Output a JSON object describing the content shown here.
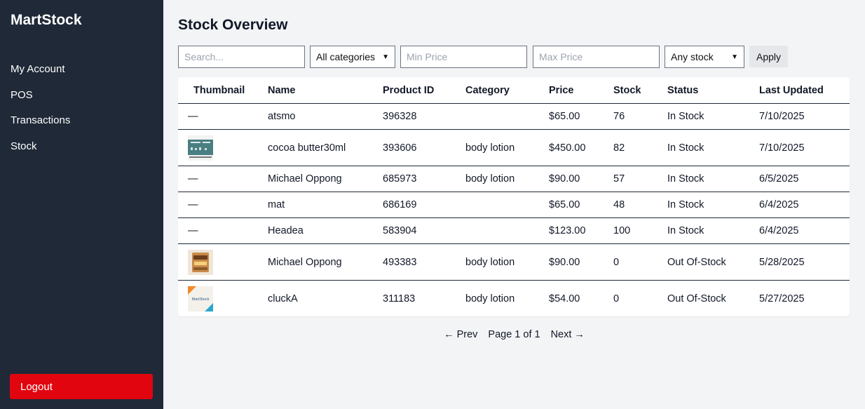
{
  "app": {
    "brand": "MartStock"
  },
  "sidebar": {
    "items": [
      {
        "label": "My Account"
      },
      {
        "label": "POS"
      },
      {
        "label": "Transactions"
      },
      {
        "label": "Stock"
      }
    ],
    "logout_label": "Logout"
  },
  "page": {
    "title": "Stock Overview"
  },
  "filters": {
    "search_placeholder": "Search...",
    "category_selected": "All categories",
    "min_price_placeholder": "Min Price",
    "max_price_placeholder": "Max Price",
    "stock_selected": "Any stock",
    "apply_label": "Apply"
  },
  "table": {
    "headers": [
      "Thumbnail",
      "Name",
      "Product ID",
      "Category",
      "Price",
      "Stock",
      "Status",
      "Last Updated"
    ],
    "rows": [
      {
        "thumbnail": "—",
        "name": "atsmo",
        "id": "396328",
        "category": "",
        "price": "$65.00",
        "stock": "76",
        "status": "In Stock",
        "updated": "7/10/2025"
      },
      {
        "thumbnail": "image",
        "name": "cocoa butter30ml",
        "id": "393606",
        "category": "body lotion",
        "price": "$450.00",
        "stock": "82",
        "status": "In Stock",
        "updated": "7/10/2025"
      },
      {
        "thumbnail": "—",
        "name": "Michael Oppong",
        "id": "685973",
        "category": "body lotion",
        "price": "$90.00",
        "stock": "57",
        "status": "In Stock",
        "updated": "6/5/2025"
      },
      {
        "thumbnail": "—",
        "name": "mat",
        "id": "686169",
        "category": "",
        "price": "$65.00",
        "stock": "48",
        "status": "In Stock",
        "updated": "6/4/2025"
      },
      {
        "thumbnail": "—",
        "name": "Headea",
        "id": "583904",
        "category": "",
        "price": "$123.00",
        "stock": "100",
        "status": "In Stock",
        "updated": "6/4/2025"
      },
      {
        "thumbnail": "image",
        "name": "Michael Oppong",
        "id": "493383",
        "category": "body lotion",
        "price": "$90.00",
        "stock": "0",
        "status": "Out Of-Stock",
        "updated": "5/28/2025"
      },
      {
        "thumbnail": "image",
        "name": "cluckA",
        "id": "311183",
        "category": "body lotion",
        "price": "$54.00",
        "stock": "0",
        "status": "Out Of-Stock",
        "updated": "5/27/2025"
      }
    ]
  },
  "pagination": {
    "prev_label": "← Prev",
    "page_label": "Page 1 of 1",
    "next_label": "Next →"
  },
  "thumbnail_logo_text": "MartStock",
  "colors": {
    "sidebar_bg": "#1f2937",
    "logout_bg": "#e0050f",
    "page_bg": "#f3f4f6"
  }
}
